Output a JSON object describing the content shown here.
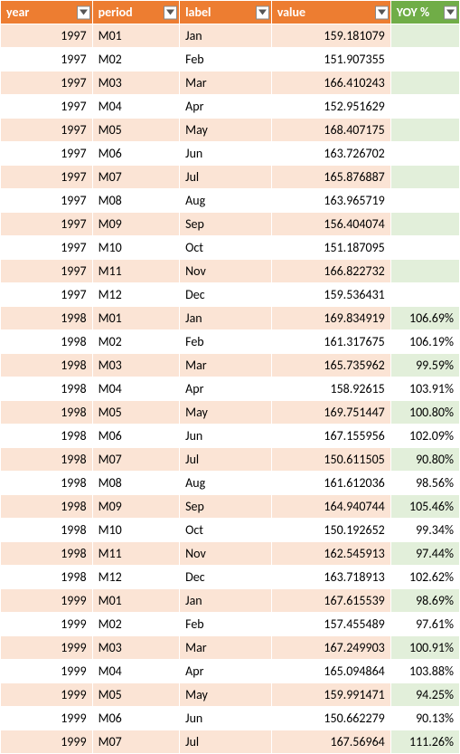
{
  "headers": {
    "year": "year",
    "period": "period",
    "label": "label",
    "value": "value",
    "yoy": "YOY %"
  },
  "rows": [
    {
      "year": "1997",
      "period": "M01",
      "label": "Jan",
      "value": "159.181079",
      "yoy": ""
    },
    {
      "year": "1997",
      "period": "M02",
      "label": "Feb",
      "value": "151.907355",
      "yoy": ""
    },
    {
      "year": "1997",
      "period": "M03",
      "label": "Mar",
      "value": "166.410243",
      "yoy": ""
    },
    {
      "year": "1997",
      "period": "M04",
      "label": "Apr",
      "value": "152.951629",
      "yoy": ""
    },
    {
      "year": "1997",
      "period": "M05",
      "label": "May",
      "value": "168.407175",
      "yoy": ""
    },
    {
      "year": "1997",
      "period": "M06",
      "label": "Jun",
      "value": "163.726702",
      "yoy": ""
    },
    {
      "year": "1997",
      "period": "M07",
      "label": "Jul",
      "value": "165.876887",
      "yoy": ""
    },
    {
      "year": "1997",
      "period": "M08",
      "label": "Aug",
      "value": "163.965719",
      "yoy": ""
    },
    {
      "year": "1997",
      "period": "M09",
      "label": "Sep",
      "value": "156.404074",
      "yoy": ""
    },
    {
      "year": "1997",
      "period": "M10",
      "label": "Oct",
      "value": "151.187095",
      "yoy": ""
    },
    {
      "year": "1997",
      "period": "M11",
      "label": "Nov",
      "value": "166.822732",
      "yoy": ""
    },
    {
      "year": "1997",
      "period": "M12",
      "label": "Dec",
      "value": "159.536431",
      "yoy": ""
    },
    {
      "year": "1998",
      "period": "M01",
      "label": "Jan",
      "value": "169.834919",
      "yoy": "106.69%"
    },
    {
      "year": "1998",
      "period": "M02",
      "label": "Feb",
      "value": "161.317675",
      "yoy": "106.19%"
    },
    {
      "year": "1998",
      "period": "M03",
      "label": "Mar",
      "value": "165.735962",
      "yoy": "99.59%"
    },
    {
      "year": "1998",
      "period": "M04",
      "label": "Apr",
      "value": "158.92615",
      "yoy": "103.91%"
    },
    {
      "year": "1998",
      "period": "M05",
      "label": "May",
      "value": "169.751447",
      "yoy": "100.80%"
    },
    {
      "year": "1998",
      "period": "M06",
      "label": "Jun",
      "value": "167.155956",
      "yoy": "102.09%"
    },
    {
      "year": "1998",
      "period": "M07",
      "label": "Jul",
      "value": "150.611505",
      "yoy": "90.80%"
    },
    {
      "year": "1998",
      "period": "M08",
      "label": "Aug",
      "value": "161.612036",
      "yoy": "98.56%"
    },
    {
      "year": "1998",
      "period": "M09",
      "label": "Sep",
      "value": "164.940744",
      "yoy": "105.46%"
    },
    {
      "year": "1998",
      "period": "M10",
      "label": "Oct",
      "value": "150.192652",
      "yoy": "99.34%"
    },
    {
      "year": "1998",
      "period": "M11",
      "label": "Nov",
      "value": "162.545913",
      "yoy": "97.44%"
    },
    {
      "year": "1998",
      "period": "M12",
      "label": "Dec",
      "value": "163.718913",
      "yoy": "102.62%"
    },
    {
      "year": "1999",
      "period": "M01",
      "label": "Jan",
      "value": "167.615539",
      "yoy": "98.69%"
    },
    {
      "year": "1999",
      "period": "M02",
      "label": "Feb",
      "value": "157.455489",
      "yoy": "97.61%"
    },
    {
      "year": "1999",
      "period": "M03",
      "label": "Mar",
      "value": "167.249903",
      "yoy": "100.91%"
    },
    {
      "year": "1999",
      "period": "M04",
      "label": "Apr",
      "value": "165.094864",
      "yoy": "103.88%"
    },
    {
      "year": "1999",
      "period": "M05",
      "label": "May",
      "value": "159.991471",
      "yoy": "94.25%"
    },
    {
      "year": "1999",
      "period": "M06",
      "label": "Jun",
      "value": "150.662279",
      "yoy": "90.13%"
    },
    {
      "year": "1999",
      "period": "M07",
      "label": "Jul",
      "value": "167.56964",
      "yoy": "111.26%"
    }
  ]
}
